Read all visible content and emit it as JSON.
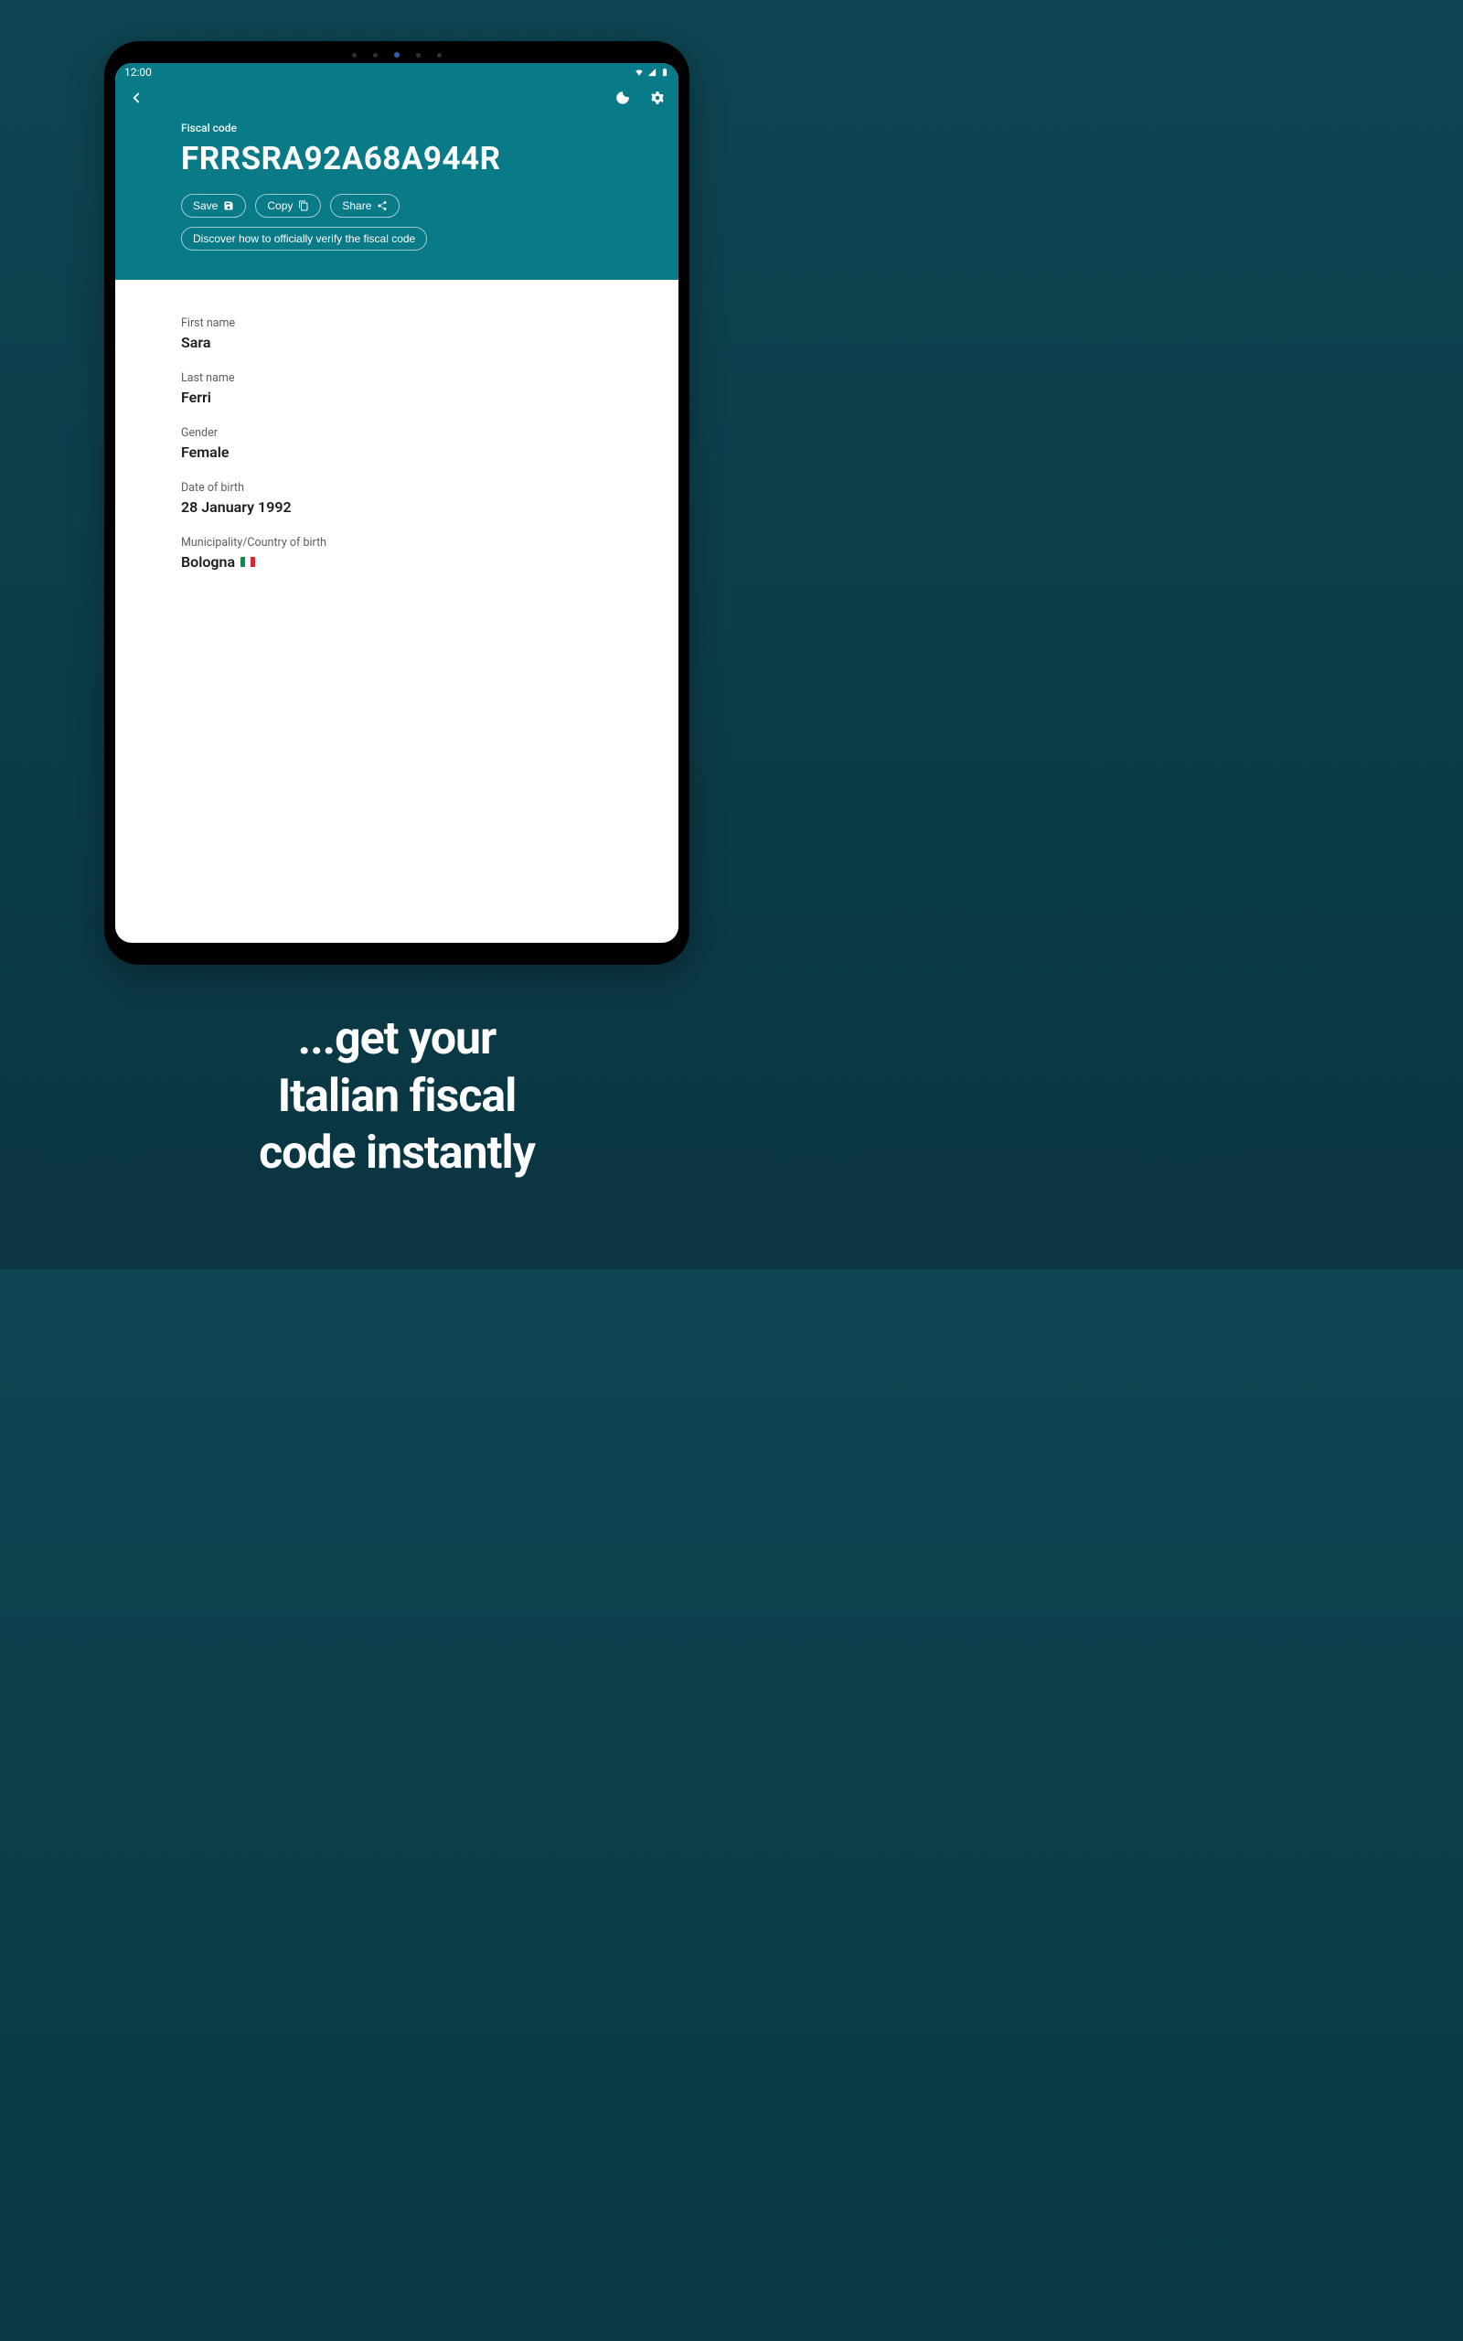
{
  "status": {
    "time": "12:00"
  },
  "header": {
    "label": "Fiscal code",
    "code": "FRRSRA92A68A944R",
    "actions": {
      "save": "Save",
      "copy": "Copy",
      "share": "Share"
    },
    "verify_label": "Discover how to officially verify the fiscal code"
  },
  "fields": {
    "first_name": {
      "label": "First name",
      "value": "Sara"
    },
    "last_name": {
      "label": "Last name",
      "value": "Ferri"
    },
    "gender": {
      "label": "Gender",
      "value": "Female"
    },
    "dob": {
      "label": "Date of birth",
      "value": "28 January 1992"
    },
    "birthplace": {
      "label": "Municipality/Country of birth",
      "value": "Bologna"
    }
  },
  "tagline": "...get your\nItalian fiscal\ncode instantly"
}
